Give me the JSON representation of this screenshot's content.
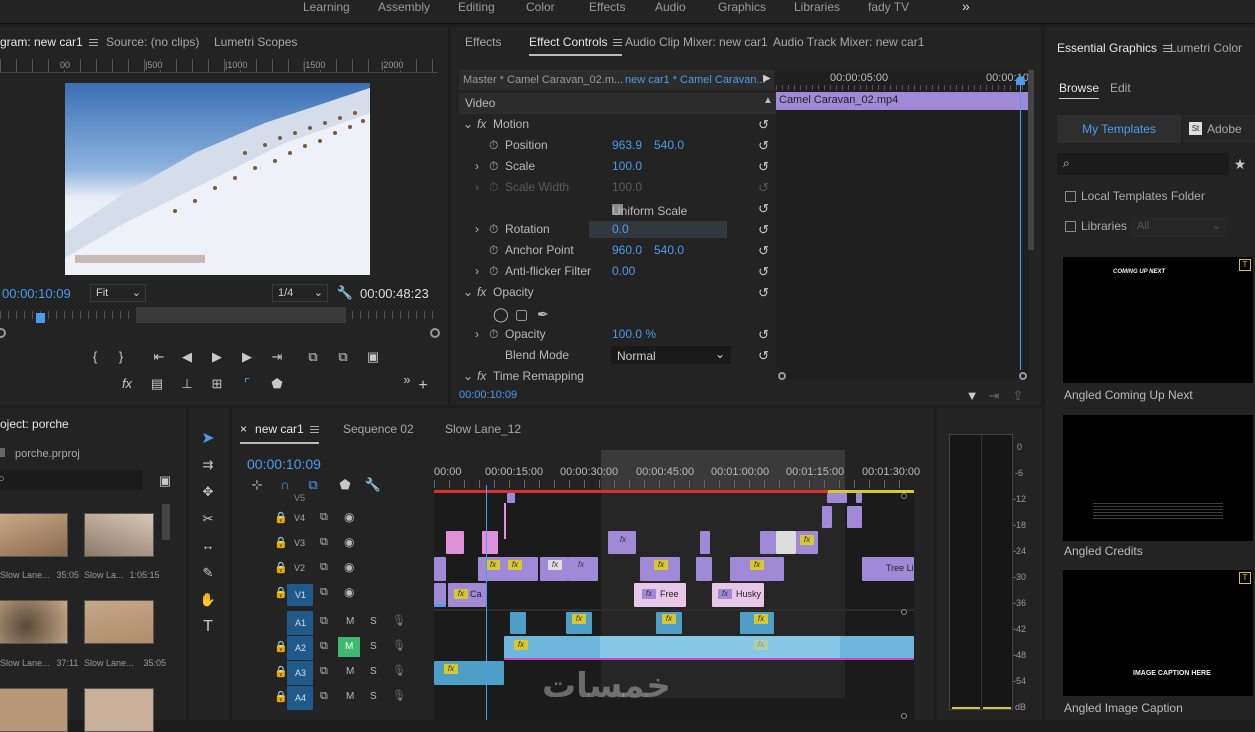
{
  "workspaces": [
    "Learning",
    "Assembly",
    "Editing",
    "Color",
    "Effects",
    "Audio",
    "Graphics",
    "Libraries",
    "fady TV"
  ],
  "program": {
    "tabs": [
      "gram: new car1",
      "Source: (no clips)",
      "Lumetri Scopes"
    ],
    "ruler": [
      "00",
      "|500",
      "|1000",
      "|1500",
      "|2000"
    ],
    "timecode": "00:00:10:09",
    "fit": "Fit",
    "resolution": "1/4",
    "duration": "00:00:48:23"
  },
  "effect_controls": {
    "tabs": [
      "Effects",
      "Effect Controls",
      "Audio Clip Mixer: new car1",
      "Audio Track Mixer: new car1"
    ],
    "master": "Master * Camel Caravan_02.m...",
    "sequence": "new car1 * Camel Caravan...",
    "time_label": "00:00:05:00",
    "time_label_right": "00:00:10",
    "clip_name": "Camel Caravan_02.mp4",
    "section_video": "Video",
    "motion": "Motion",
    "props": {
      "position": {
        "label": "Position",
        "x": "963.9",
        "y": "540.0"
      },
      "scale": {
        "label": "Scale",
        "v": "100.0"
      },
      "scale_width": {
        "label": "Scale Width",
        "v": "100.0"
      },
      "uniform": "Uniform Scale",
      "rotation": {
        "label": "Rotation",
        "v": "0.0"
      },
      "anchor": {
        "label": "Anchor Point",
        "x": "960.0",
        "y": "540.0"
      },
      "antiflicker": {
        "label": "Anti-flicker Filter",
        "v": "0.00"
      },
      "opacity_section": "Opacity",
      "opacity": {
        "label": "Opacity",
        "v": "100.0 %"
      },
      "blend": {
        "label": "Blend Mode",
        "v": "Normal"
      },
      "time_remap": "Time Remapping"
    },
    "bottom_timecode": "00:00:10:09"
  },
  "essential": {
    "tabs": [
      "Essential Graphics",
      "Lumetri Color"
    ],
    "subtabs": [
      "Browse",
      "Edit"
    ],
    "my_templates": "My Templates",
    "adobe": "Adobe",
    "local_templates": "Local Templates Folder",
    "libraries": "Libraries",
    "libraries_select": "All",
    "templates": [
      {
        "name": "Angled Coming Up Next",
        "thumb_text_a": "COMING UP ",
        "thumb_text_b": "NEXT"
      },
      {
        "name": "Angled Credits"
      },
      {
        "name": "Angled Image Caption",
        "thumb_text": "IMAGE CAPTION HERE"
      }
    ]
  },
  "project": {
    "title": "oject: porche",
    "file": "porche.prproj",
    "items": [
      {
        "name": "Slow Lane...",
        "dur": "35:05"
      },
      {
        "name": "Slow La...",
        "dur": "1:05:15"
      },
      {
        "name": "Slow Lane...",
        "dur": "37:11"
      },
      {
        "name": "Slow Lane...",
        "dur": "35:05"
      }
    ]
  },
  "timeline": {
    "tabs": [
      "new car1",
      "Sequence 02",
      "Slow Lane_12"
    ],
    "timecode": "00:00:10:09",
    "ruler": [
      "00:00",
      "00:00:15:00",
      "00:00:30:00",
      "00:00:45:00",
      "00:01:00:00",
      "00:01:15:00",
      "00:01:30:00"
    ],
    "video_tracks": [
      "V5",
      "V4",
      "V3",
      "V2",
      "V1"
    ],
    "audio_tracks": [
      "A1",
      "A2",
      "A3",
      "A4"
    ],
    "clip_labels": {
      "free": "Free",
      "husky": "Husky",
      "tree": "Tree Li",
      "ca": "Ca"
    }
  },
  "meter_scale": [
    "0",
    "-6",
    "-12",
    "-18",
    "-24",
    "-30",
    "-36",
    "-42",
    "-48",
    "-54",
    "dB"
  ],
  "watermark": "خمسات"
}
